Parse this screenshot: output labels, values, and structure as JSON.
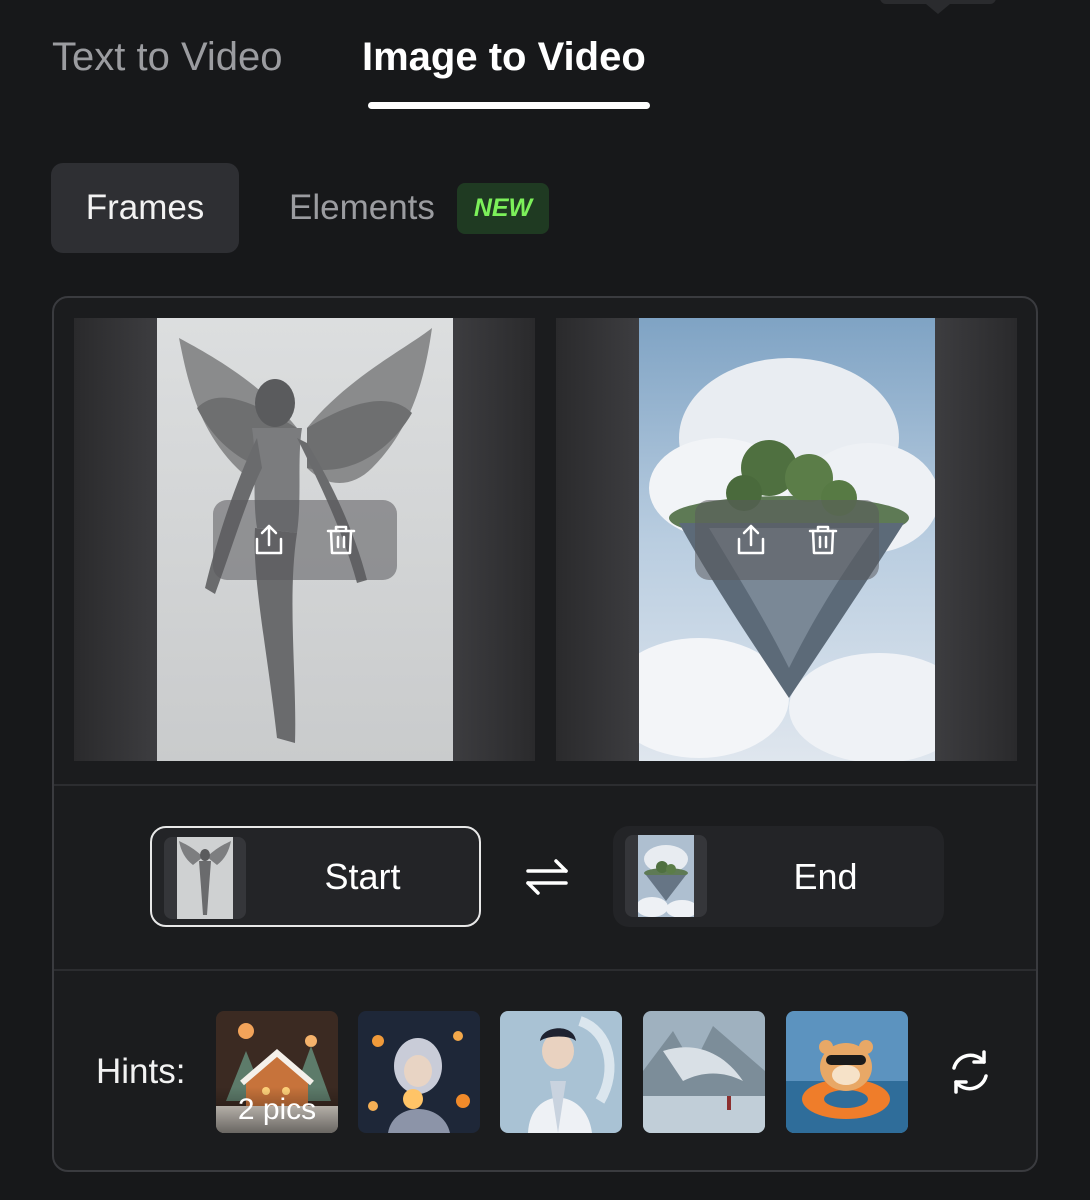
{
  "tabs": {
    "text_to_video": "Text to Video",
    "image_to_video": "Image to Video"
  },
  "subtabs": {
    "frames": "Frames",
    "elements": "Elements",
    "new_badge": "NEW"
  },
  "frames": {
    "start_label": "Start",
    "end_label": "End"
  },
  "hints": {
    "label": "Hints:",
    "first_caption": "2 pics"
  },
  "colors": {
    "background": "#17181a",
    "accent_green": "#7cf05a",
    "active_tab": "#ffffff",
    "inactive_tab": "#9b9ca0"
  }
}
